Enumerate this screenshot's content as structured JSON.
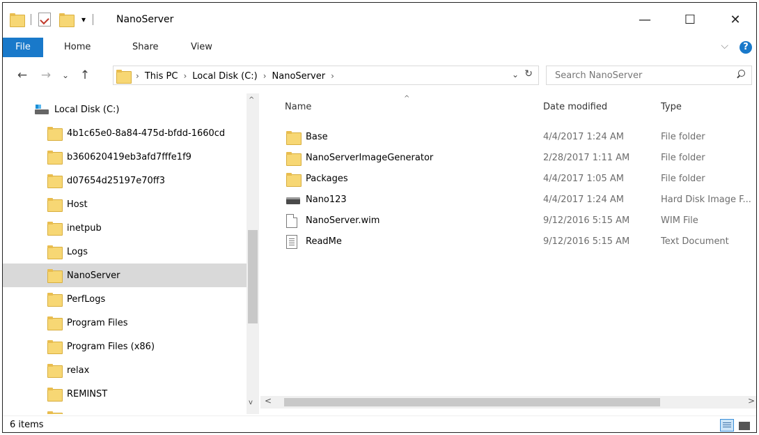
{
  "window": {
    "title": "NanoServer"
  },
  "titlebar": {
    "qa_dropdown": "▾",
    "minimize": "—",
    "maximize": "☐",
    "close": "✕"
  },
  "ribbon": {
    "tabs": [
      "File",
      "Home",
      "Share",
      "View"
    ],
    "expand": "⌵",
    "help": "?"
  },
  "nav": {
    "back": "←",
    "forward": "→",
    "recent": "⌄",
    "up": "↑"
  },
  "address": {
    "crumbs": [
      "This PC",
      "Local Disk (C:)",
      "NanoServer"
    ],
    "separator": "›",
    "dropdown": "⌄",
    "refresh": "↻"
  },
  "search": {
    "placeholder": "Search NanoServer"
  },
  "tree": {
    "root": "Local Disk (C:)",
    "items": [
      "4b1c65e0-8a84-475d-bfdd-1660cd",
      "b360620419eb3afd7fffe1f9",
      "d07654d25197e70ff3",
      "Host",
      "inetpub",
      "Logs",
      "NanoServer",
      "PerfLogs",
      "Program Files",
      "Program Files (x86)",
      "relax",
      "REMINST"
    ],
    "selected": "NanoServer"
  },
  "columns": {
    "name": "Name",
    "date": "Date modified",
    "type": "Type",
    "sort_caret": "^"
  },
  "files": [
    {
      "name": "Base",
      "date": "4/4/2017 1:24 AM",
      "type": "File folder",
      "icon": "folder-icon"
    },
    {
      "name": "NanoServerImageGenerator",
      "date": "2/28/2017 1:11 AM",
      "type": "File folder",
      "icon": "folder-icon"
    },
    {
      "name": "Packages",
      "date": "4/4/2017 1:05 AM",
      "type": "File folder",
      "icon": "folder-icon"
    },
    {
      "name": "Nano123",
      "date": "4/4/2017 1:24 AM",
      "type": "Hard Disk Image F...",
      "icon": "disk-image-icon"
    },
    {
      "name": "NanoServer.wim",
      "date": "9/12/2016 5:15 AM",
      "type": "WIM File",
      "icon": "file-icon"
    },
    {
      "name": "ReadMe",
      "date": "9/12/2016 5:15 AM",
      "type": "Text Document",
      "icon": "text-file-icon"
    }
  ],
  "scroll": {
    "up": "^",
    "down": "v",
    "left": "<",
    "right": ">"
  },
  "status": {
    "items": "6 items"
  },
  "colors": {
    "accent": "#1979ca",
    "selected": "#d9d9d9",
    "folder": "#f7d774"
  }
}
